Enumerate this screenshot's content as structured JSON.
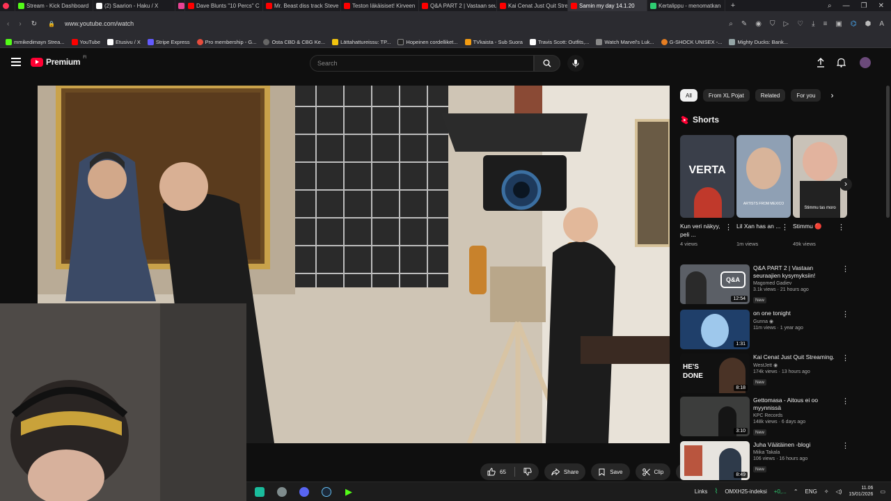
{
  "browser": {
    "tabs": [
      {
        "label": "Stream - Kick Dashboard",
        "color": "#53fc18"
      },
      {
        "label": "(2) Saarion - Haku / X",
        "color": "#ffffff"
      },
      {
        "label": "",
        "color": "#e84393"
      },
      {
        "label": "Dave Blunts \"10 Percs\" C",
        "color": "#ff0000"
      },
      {
        "label": "Mr. Beast diss track Steve",
        "color": "#ff0000"
      },
      {
        "label": "Teston läkäisiset! Kirveen",
        "color": "#ff0000"
      },
      {
        "label": "Q&A PART 2 | Vastaan seu",
        "color": "#ff0000"
      },
      {
        "label": "Kai Cenat Just Quit Stream",
        "color": "#ff0000"
      },
      {
        "label": "Samin my day 14.1.20",
        "color": "#ff0000",
        "active": true
      },
      {
        "label": "Kertalippu - menomatkan",
        "color": "#2ecc71"
      }
    ],
    "new_tab": "+",
    "url": "www.youtube.com/watch",
    "bookmarks": [
      "mmikedimayn Strea...",
      "YouTube",
      "Etusivu / X",
      "Stripe Express",
      "Pro membership - G...",
      "Osta CBD & CBG Ke...",
      "Lättahattureissu: TP...",
      "Hopeinen cordelliket...",
      "TVkaista - Sub Suora",
      "Travis Scott: Outfits,...",
      "Watch Marvel's Luk...",
      "G-SHOCK UNISEX -...",
      "Mighty Ducks: Bank..."
    ]
  },
  "youtube": {
    "logo_text": "Premium",
    "region": "FI",
    "search_placeholder": "Search"
  },
  "actions": {
    "likes": "65",
    "share": "Share",
    "save": "Save",
    "clip": "Clip"
  },
  "chips": [
    "All",
    "From XL Pojat",
    "Related",
    "For you"
  ],
  "shorts": {
    "heading": "Shorts",
    "items": [
      {
        "title": "Kun veri näkyy, peli ...",
        "views": "4 views",
        "overlay": "VERTA"
      },
      {
        "title": "Lil Xan has an ...",
        "views": "1m views",
        "overlay": "ARTISTS FROM MEXICO"
      },
      {
        "title": "Stimmu 🔴",
        "views": "49k views",
        "overlay": "Stimmu tas moro"
      }
    ]
  },
  "videos": [
    {
      "title": "Q&A PART 2 | Vastaan seuraajien kysymyksiin!",
      "channel": "Magomed Gadiev",
      "views": "3.1k views · 21 hours ago",
      "duration": "12:54",
      "badge": "New",
      "thumb_text": "Q&A"
    },
    {
      "title": "on one tonight",
      "channel": "Gunna",
      "views": "11m views · 1 year ago",
      "duration": "1:31",
      "badge": "",
      "thumb_text": ""
    },
    {
      "title": "Kai Cenat Just Quit Streaming.",
      "channel": "WestJett",
      "views": "174k views · 13 hours ago",
      "duration": "8:18",
      "badge": "New",
      "thumb_text": "HE'S DONE"
    },
    {
      "title": "Gettomasa - Aitous ei oo myynnissä",
      "channel": "KPC Records",
      "views": "148k views · 6 days ago",
      "duration": "3:10",
      "badge": "New",
      "thumb_text": ""
    },
    {
      "title": "Juha Väätäinen -blogi",
      "channel": "Miika Takala",
      "views": "106 views · 16 hours ago",
      "duration": "8:49",
      "badge": "New",
      "thumb_text": ""
    }
  ],
  "taskbar": {
    "links": "Links",
    "stock": "OMXH25-indeksi",
    "stock_change": "+0,...",
    "lang": "ENG",
    "time": "11.06",
    "date": "15/01/2026"
  }
}
